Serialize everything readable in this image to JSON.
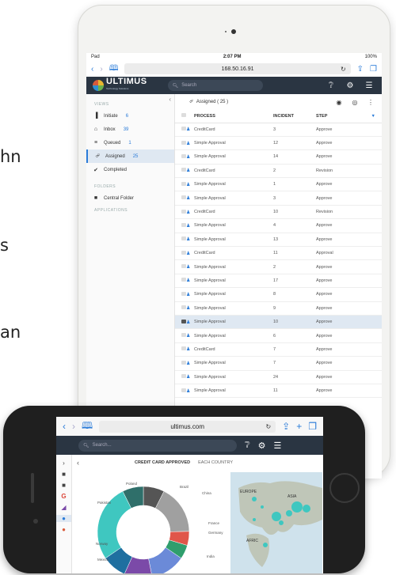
{
  "background_text": [
    "hn",
    "s",
    "an"
  ],
  "tablet": {
    "status": {
      "carrier": "Pad",
      "time": "2:07 PM",
      "battery": "100%"
    },
    "browser": {
      "url": "168.50.16.91"
    },
    "app": {
      "brand": "ULTIMUS",
      "brand_sub": "Technology Solutions",
      "search_placeholder": "Search",
      "icons": [
        "help-icon",
        "settings-icon",
        "menu-icon"
      ]
    },
    "sidebar": {
      "views_title": "VIEWS",
      "views": [
        {
          "label": "Initiate",
          "count": "6",
          "icon": "initiate-icon"
        },
        {
          "label": "Inbox",
          "count": "39",
          "icon": "inbox-icon"
        },
        {
          "label": "Queued",
          "count": "1",
          "icon": "queued-icon"
        },
        {
          "label": "Assigned",
          "count": "25",
          "icon": "assigned-icon",
          "active": true
        },
        {
          "label": "Completed",
          "count": "",
          "icon": "completed-icon"
        }
      ],
      "folders_title": "FOLDERS",
      "folders": [
        {
          "label": "Central Folder",
          "icon": "folder-icon"
        }
      ],
      "applications_title": "APPLICATIONS"
    },
    "content": {
      "toolbar_title": "Assigned ( 25 )",
      "columns": [
        "PROCESS",
        "INCIDENT",
        "STEP"
      ],
      "rows": [
        {
          "process": "CreditCard",
          "incident": "3",
          "step": "Approve"
        },
        {
          "process": "Simple Approval",
          "incident": "12",
          "step": "Approve"
        },
        {
          "process": "Simple Approval",
          "incident": "14",
          "step": "Approve"
        },
        {
          "process": "CreditCard",
          "incident": "2",
          "step": "Revision"
        },
        {
          "process": "Simple Approval",
          "incident": "1",
          "step": "Approve"
        },
        {
          "process": "Simple Approval",
          "incident": "3",
          "step": "Approve"
        },
        {
          "process": "CreditCard",
          "incident": "10",
          "step": "Revision"
        },
        {
          "process": "Simple Approval",
          "incident": "4",
          "step": "Approve"
        },
        {
          "process": "Simple Approval",
          "incident": "13",
          "step": "Approve"
        },
        {
          "process": "CreditCard",
          "incident": "11",
          "step": "Approval"
        },
        {
          "process": "Simple Approval",
          "incident": "2",
          "step": "Approve"
        },
        {
          "process": "Simple Approval",
          "incident": "17",
          "step": "Approve"
        },
        {
          "process": "Simple Approval",
          "incident": "8",
          "step": "Approve"
        },
        {
          "process": "Simple Approval",
          "incident": "9",
          "step": "Approve"
        },
        {
          "process": "Simple Approval",
          "incident": "10",
          "step": "Approve",
          "selected": true
        },
        {
          "process": "Simple Approval",
          "incident": "6",
          "step": "Approve"
        },
        {
          "process": "CreditCard",
          "incident": "7",
          "step": "Approve"
        },
        {
          "process": "Simple Approval",
          "incident": "7",
          "step": "Approve"
        },
        {
          "process": "Simple Approval",
          "incident": "24",
          "step": "Approve"
        },
        {
          "process": "Simple Approval",
          "incident": "11",
          "step": "Approve"
        }
      ]
    }
  },
  "phone": {
    "browser": {
      "url": "ultimus.com"
    },
    "search_placeholder": "Search...",
    "tabs": [
      "CREDIT CARD APPROVED",
      "EACH COUNTRY"
    ],
    "chart_labels": [
      "Poland",
      "Brazil",
      "China",
      "Pakistan",
      "France",
      "Germany",
      "Norway",
      "India",
      "Mexico"
    ],
    "map_labels": [
      "EUROPE",
      "ASIA",
      "AFRIC"
    ],
    "chart_data": {
      "type": "pie",
      "title": "",
      "categories": [
        "Brazil",
        "China",
        "France",
        "Germany",
        "India",
        "Mexico",
        "Norway",
        "Pakistan",
        "Poland"
      ],
      "values": [
        6,
        14,
        4,
        4,
        10,
        8,
        7,
        22,
        6
      ],
      "colors": [
        "#555555",
        "#a0a0a0",
        "#e0564a",
        "#2f9e6d",
        "#6b8ad8",
        "#7b4aa8",
        "#1f6fa0",
        "#3fc7c0",
        "#2f6f6a"
      ]
    }
  }
}
